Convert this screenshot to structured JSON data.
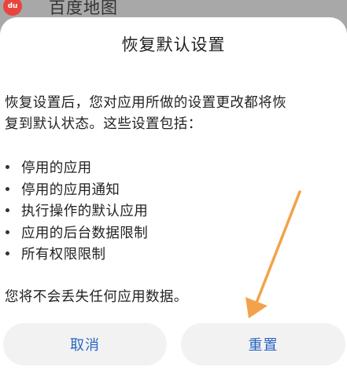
{
  "app": {
    "icon_text": "du",
    "name": "百度地图",
    "brand_color": "#e8453c"
  },
  "dialog": {
    "title": "恢复默认设置",
    "body_line_1": "恢复设置后，您对应用所做的设置更改都将恢",
    "body_line_2": "复到默认状态。这些设置包括：",
    "items": [
      "停用的应用",
      "停用的应用通知",
      "执行操作的默认应用",
      "应用的后台数据限制",
      "所有权限限制"
    ],
    "footer": "您将不会丢失任何应用数据。",
    "buttons": {
      "cancel": "取消",
      "reset": "重置"
    },
    "accent_color": "#2a66c4"
  },
  "annotation": {
    "icon": "orange-arrow-pointing-to-reset-button",
    "color": "#f3a24a"
  }
}
